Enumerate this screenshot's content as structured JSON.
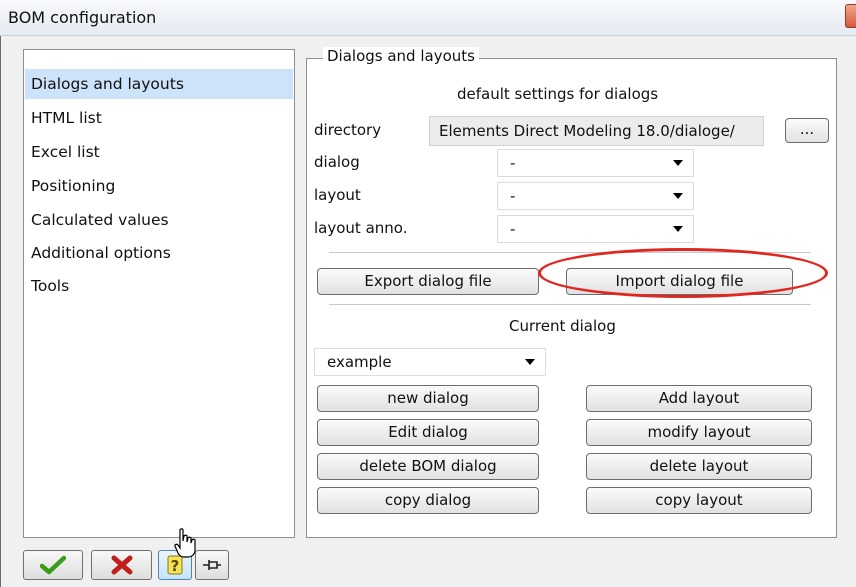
{
  "window": {
    "title": "BOM configuration"
  },
  "sidebar": {
    "items": [
      {
        "label": "Dialogs and layouts",
        "selected": true
      },
      {
        "label": "HTML list"
      },
      {
        "label": "Excel list"
      },
      {
        "label": "Positioning"
      },
      {
        "label": "Calculated values"
      },
      {
        "label": "Additional options"
      },
      {
        "label": "Tools"
      }
    ]
  },
  "group": {
    "legend": "Dialogs and layouts",
    "subtitle": "default settings for dialogs",
    "directory": {
      "label": "directory",
      "value": "Elements Direct Modeling 18.0/dialoge/",
      "browse_label": "..."
    },
    "dialog": {
      "label": "dialog",
      "value": "-"
    },
    "layout": {
      "label": "layout",
      "value": "-"
    },
    "layout_anno": {
      "label": "layout anno.",
      "value": "-"
    },
    "export_label": "Export dialog file",
    "import_label": "Import dialog file",
    "current_title": "Current dialog",
    "current_value": "example",
    "buttons": {
      "new_dialog": "new dialog",
      "add_layout": "Add layout",
      "edit_dialog": "Edit dialog",
      "modify_layout": "modify layout",
      "delete_bom_dialog": "delete BOM dialog",
      "delete_layout": "delete layout",
      "copy_dialog": "copy dialog",
      "copy_layout": "copy layout"
    }
  },
  "toolbar": {
    "ok_icon": "check-icon",
    "cancel_icon": "x-icon",
    "help_icon": "question-icon",
    "pin_icon": "pin-icon"
  },
  "colors": {
    "accent_highlight": "#cde3fa",
    "annotation_red": "#e0271f"
  }
}
